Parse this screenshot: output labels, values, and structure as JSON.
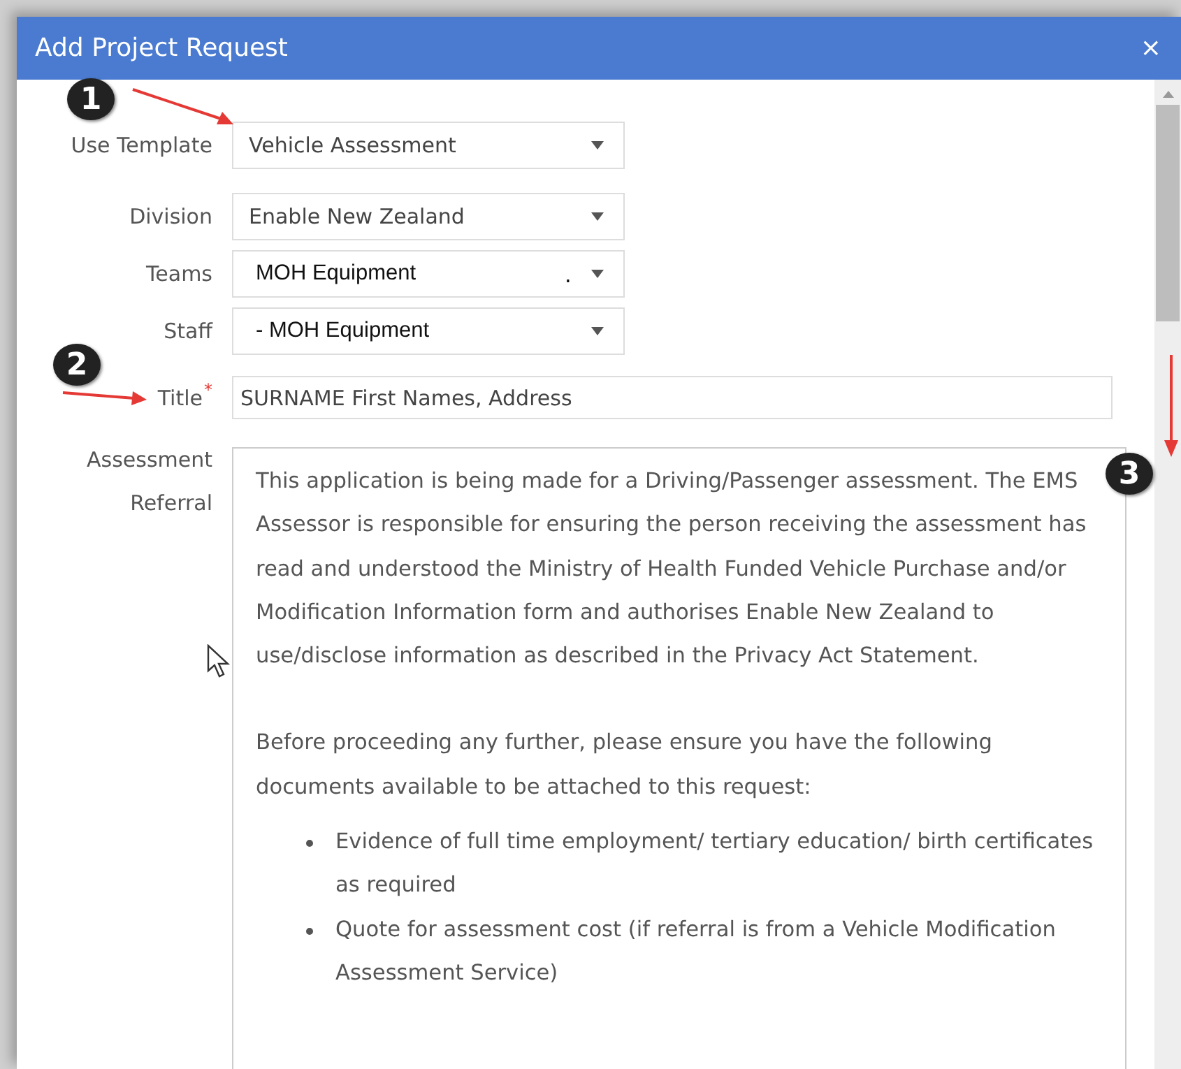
{
  "window": {
    "title": "Add Project Request",
    "close": "×"
  },
  "fields": [
    {
      "kind": "select",
      "label": "Use Template",
      "value": "Vehicle Assessment"
    },
    {
      "kind": "select",
      "label": "Division",
      "value": "Enable New Zealand"
    },
    {
      "kind": "select",
      "label": "Teams",
      "value": "MOH Equipment",
      "suffix": ".",
      "bold": true
    },
    {
      "kind": "select",
      "label": "Staff",
      "value": "- MOH Equipment",
      "bold": true
    },
    {
      "kind": "text",
      "label": "Title",
      "marker": "*",
      "value": "SURNAME First Names, Address"
    }
  ],
  "referral": {
    "label": [
      "Assessment",
      "Referral"
    ],
    "paragraphs": [
      "This application is being made for a Driving/Passenger assessment. The EMS Assessor is responsible for ensuring the person receiving the assessment has read and understood the Ministry of Health Funded Vehicle Purchase and/or Modification Information form and authorises Enable New Zealand to use/disclose information as described in the Privacy Act Statement.",
      "Before proceeding any further, please ensure you have the following documents available to be attached to this request:"
    ],
    "bullets": [
      "Evidence of full time employment/ tertiary education/ birth certificates as required",
      "Quote for assessment cost (if referral is from a Vehicle Modification Assessment Service)"
    ]
  },
  "callouts": [
    "1",
    "2",
    "3"
  ]
}
